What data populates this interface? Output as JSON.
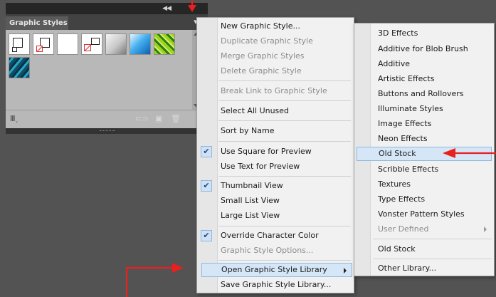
{
  "panel": {
    "collapse_icon": "double-chevron-left-icon",
    "tab_label": "Graphic Styles",
    "menu_icon": "panel-menu-icon",
    "footer_icons": [
      "libraries-menu-icon",
      "break-link-icon",
      "new-style-icon",
      "delete-icon"
    ]
  },
  "menu": {
    "items": [
      {
        "label": "New Graphic Style...",
        "enabled": true
      },
      {
        "label": "Duplicate Graphic Style",
        "enabled": false
      },
      {
        "label": "Merge Graphic Styles",
        "enabled": false
      },
      {
        "label": "Delete Graphic Style",
        "enabled": false
      },
      {
        "label": "Break Link to Graphic Style",
        "enabled": false
      },
      {
        "label": "Select All Unused",
        "enabled": true
      },
      {
        "label": "Sort by Name",
        "enabled": true
      },
      {
        "label": "Use Square for Preview",
        "enabled": true,
        "checked": true
      },
      {
        "label": "Use Text for Preview",
        "enabled": true
      },
      {
        "label": "Thumbnail View",
        "enabled": true,
        "checked": true
      },
      {
        "label": "Small List View",
        "enabled": true
      },
      {
        "label": "Large List View",
        "enabled": true
      },
      {
        "label": "Override Character Color",
        "enabled": true,
        "checked": true
      },
      {
        "label": "Graphic Style Options...",
        "enabled": false
      },
      {
        "label": "Open Graphic Style Library",
        "enabled": true,
        "highlighted": true,
        "has_submenu": true
      },
      {
        "label": "Save Graphic Style Library...",
        "enabled": true
      }
    ]
  },
  "submenu": {
    "items": [
      {
        "label": "3D Effects",
        "enabled": true
      },
      {
        "label": "Additive for Blob Brush",
        "enabled": true
      },
      {
        "label": "Additive",
        "enabled": true
      },
      {
        "label": "Artistic Effects",
        "enabled": true
      },
      {
        "label": "Buttons and Rollovers",
        "enabled": true
      },
      {
        "label": "Illuminate Styles",
        "enabled": true
      },
      {
        "label": "Image Effects",
        "enabled": true
      },
      {
        "label": "Neon Effects",
        "enabled": true
      },
      {
        "label": "Old Stock",
        "enabled": true,
        "highlighted": true
      },
      {
        "label": "Scribble Effects",
        "enabled": true
      },
      {
        "label": "Textures",
        "enabled": true
      },
      {
        "label": "Type Effects",
        "enabled": true
      },
      {
        "label": "Vonster Pattern Styles",
        "enabled": true
      },
      {
        "label": "User Defined",
        "enabled": false,
        "has_submenu": true
      },
      {
        "label": "Old Stock",
        "enabled": true
      },
      {
        "label": "Other Library...",
        "enabled": true
      }
    ]
  },
  "colors": {
    "highlight": "#d5e6f7",
    "annotation": "#e8201e",
    "panel_dark": "#262626"
  }
}
